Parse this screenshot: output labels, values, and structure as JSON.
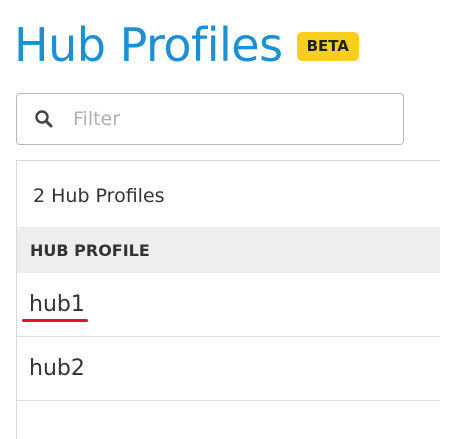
{
  "header": {
    "title": "Hub Profiles",
    "badge": "BETA",
    "badge_color": "#f8d01c",
    "title_color": "#1e8fd2"
  },
  "filter": {
    "placeholder": "Filter",
    "value": "",
    "icon": "search-icon"
  },
  "list": {
    "count_text": "2 Hub Profiles",
    "column_header": "HUB PROFILE",
    "rows": [
      {
        "name": "hub1",
        "highlighted": true,
        "highlight_color": "#e8111b"
      },
      {
        "name": "hub2",
        "highlighted": false
      }
    ]
  }
}
